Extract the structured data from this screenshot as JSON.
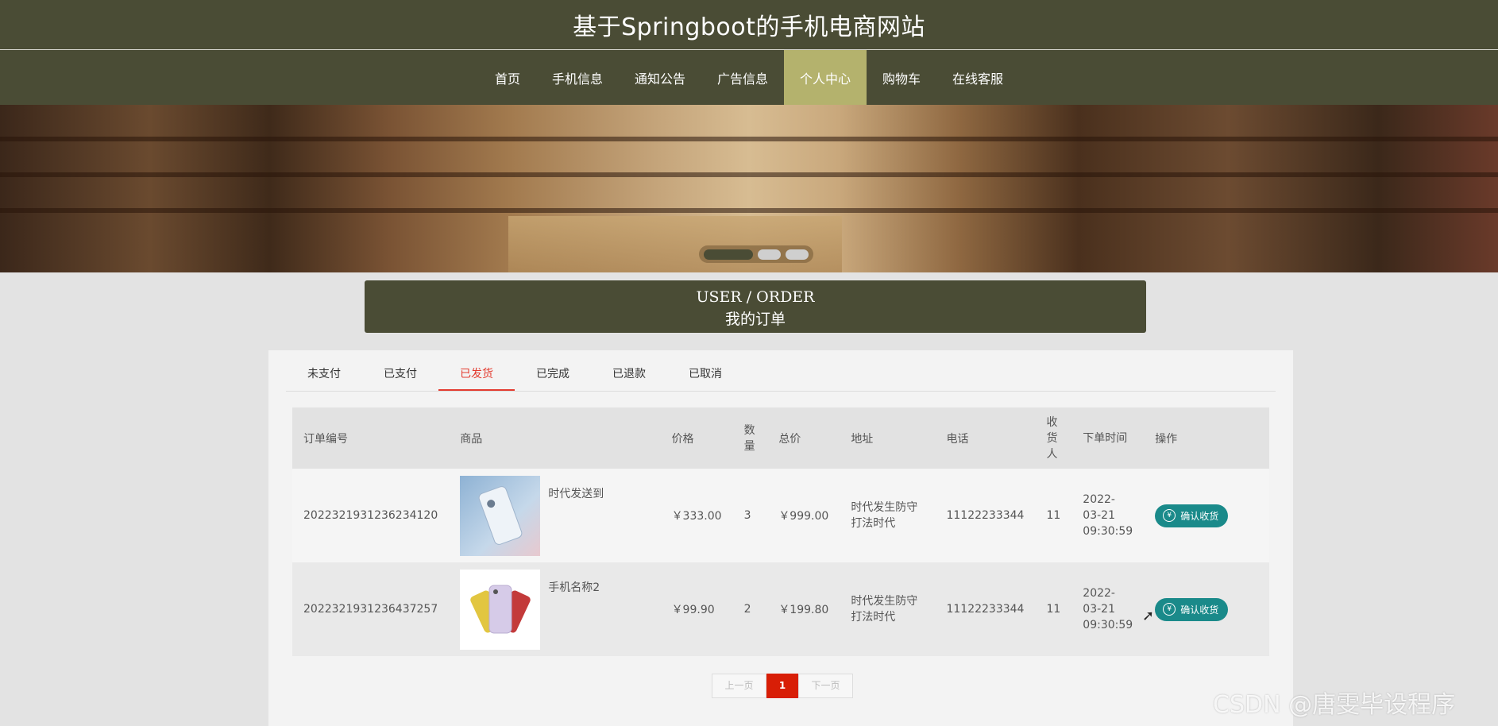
{
  "header": {
    "title": "基于Springboot的手机电商网站"
  },
  "nav": {
    "items": [
      {
        "label": "首页",
        "active": false
      },
      {
        "label": "手机信息",
        "active": false
      },
      {
        "label": "通知公告",
        "active": false
      },
      {
        "label": "广告信息",
        "active": false
      },
      {
        "label": "个人中心",
        "active": true
      },
      {
        "label": "购物车",
        "active": false
      },
      {
        "label": "在线客服",
        "active": false
      }
    ]
  },
  "section": {
    "title_en": "USER / ORDER",
    "title_zh": "我的订单"
  },
  "tabs": [
    {
      "label": "未支付"
    },
    {
      "label": "已支付"
    },
    {
      "label": "已发货",
      "active": true
    },
    {
      "label": "已完成"
    },
    {
      "label": "已退款"
    },
    {
      "label": "已取消"
    }
  ],
  "table": {
    "headers": [
      "订单编号",
      "商品",
      "价格",
      "数量",
      "总价",
      "地址",
      "电话",
      "收货人",
      "下单时间",
      "操作"
    ],
    "rows": [
      {
        "order_no": "2022321931236234120",
        "product_name": "时代发送到",
        "price": "￥333.00",
        "qty": "3",
        "total": "￥999.00",
        "address": "时代发生防守打法时代",
        "phone": "11122233344",
        "receiver": "11",
        "time": "2022-03-21 09:30:59",
        "action": "确认收货"
      },
      {
        "order_no": "2022321931236437257",
        "product_name": "手机名称2",
        "price": "￥99.90",
        "qty": "2",
        "total": "￥199.80",
        "address": "时代发生防守打法时代",
        "phone": "11122233344",
        "receiver": "11",
        "time": "2022-03-21 09:30:59",
        "action": "确认收货"
      }
    ]
  },
  "pagination": {
    "prev": "上一页",
    "current": "1",
    "next": "下一页"
  },
  "watermark": "CSDN @唐雯毕设程序",
  "colors": {
    "header_bg": "#4a4c35",
    "nav_active": "#b4b26d",
    "tab_active": "#e33b2f",
    "action_btn": "#1a8a8a",
    "page_active": "#d81e06"
  }
}
